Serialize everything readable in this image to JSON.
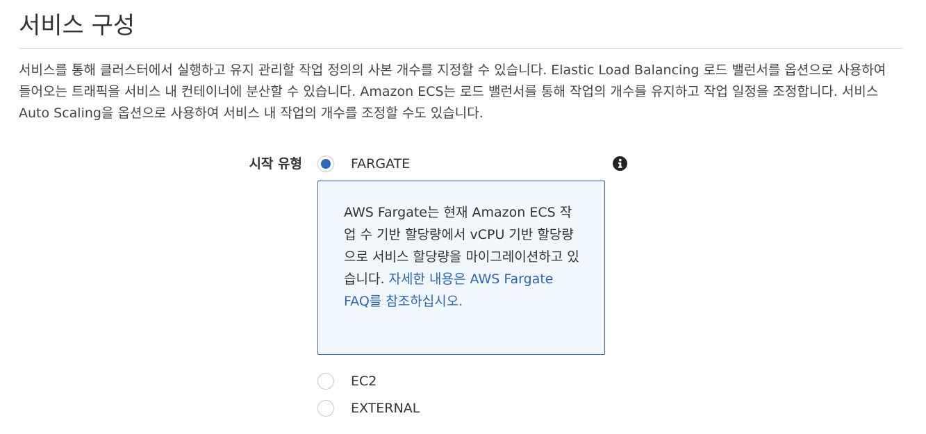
{
  "section": {
    "title": "서비스 구성",
    "description": "서비스를 통해 클러스터에서 실행하고 유지 관리할 작업 정의의 사본 개수를 지정할 수 있습니다. Elastic Load Balancing 로드 밸런서를 옵션으로 사용하여 들어오는 트래픽을 서비스 내 컨테이너에 분산할 수 있습니다. Amazon ECS는 로드 밸런서를 통해 작업의 개수를 유지하고 작업 일정을 조정합니다. 서비스 Auto Scaling을 옵션으로 사용하여 서비스 내 작업의 개수를 조정할 수도 있습니다."
  },
  "launch_type": {
    "label": "시작 유형",
    "selected": "FARGATE",
    "options": [
      {
        "label": "FARGATE",
        "checked": true
      },
      {
        "label": "EC2",
        "checked": false
      },
      {
        "label": "EXTERNAL",
        "checked": false
      }
    ],
    "info_icon": "info-icon",
    "info_box": {
      "text": "AWS Fargate는 현재 Amazon ECS 작업 수 기반 할당량에서 vCPU 기반 할당량으로 서비스 할당량을 마이그레이션하고 있습니다. ",
      "link_text": "자세한 내용은 AWS Fargate FAQ를 참조하십시오."
    }
  },
  "colors": {
    "accent": "#2e6bb7",
    "link": "#2c66b5",
    "info_box_border": "#2f67a8",
    "info_box_background": "#f1f7fc"
  }
}
